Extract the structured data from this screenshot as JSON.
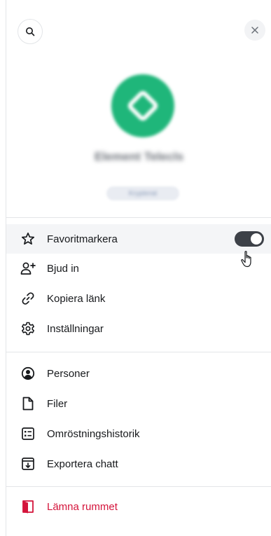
{
  "header": {
    "search_icon": "search-icon",
    "close_icon": "close-icon"
  },
  "room": {
    "name": "Element Telecls",
    "badge": "Krypterat",
    "avatar_color": "#1fb67a"
  },
  "menu": {
    "favourite": {
      "label": "Favoritmarkera",
      "toggle_on": true
    },
    "invite": {
      "label": "Bjud in"
    },
    "copy_link": {
      "label": "Kopiera länk"
    },
    "settings": {
      "label": "Inställningar"
    },
    "people": {
      "label": "Personer"
    },
    "files": {
      "label": "Filer"
    },
    "poll_history": {
      "label": "Omröstningshistorik"
    },
    "export_chat": {
      "label": "Exportera chatt"
    },
    "leave_room": {
      "label": "Lämna rummet"
    }
  },
  "colors": {
    "danger": "#d4143b",
    "text": "#17191c",
    "toggle_on": "#3d4148"
  }
}
